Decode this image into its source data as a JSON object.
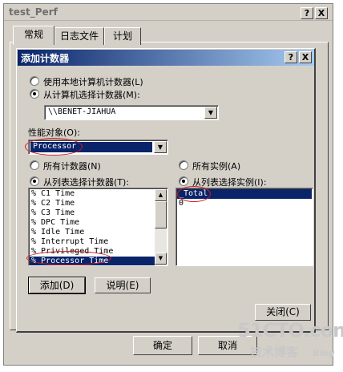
{
  "outer": {
    "title": "test_Perf",
    "help_label": "?",
    "close_label": "X",
    "tabs": [
      "常规",
      "日志文件",
      "计划"
    ],
    "buttons": {
      "ok": "确定",
      "cancel": "取消"
    }
  },
  "dialog": {
    "title": "添加计数器",
    "help_label": "?",
    "close_label": "X",
    "radio_local": "使用本地计算机计数器(L)",
    "radio_select": "从计算机选择计数器(M):",
    "computer_value": "\\\\BENET-JIAHUA",
    "perf_object_label": "性能对象(O):",
    "perf_object_value": "Processor",
    "radio_all_counters": "所有计数器(N)",
    "radio_list_counters": "从列表选择计数器(T):",
    "radio_all_instances": "所有实例(A)",
    "radio_list_instances": "从列表选择实例(I):",
    "counters": [
      "% C1 Time",
      "% C2 Time",
      "% C3 Time",
      "% DPC Time",
      "% Idle Time",
      "% Interrupt Time",
      "% Privileged Time",
      "% Processor Time"
    ],
    "instances": [
      "_Total",
      "0"
    ],
    "add_button": "添加(D)",
    "explain_button": "说明(E)",
    "close_button": "关闭(C)"
  },
  "watermark": {
    "site": "51CTO.com",
    "sub": "技术博客",
    "blog": "Blog"
  }
}
